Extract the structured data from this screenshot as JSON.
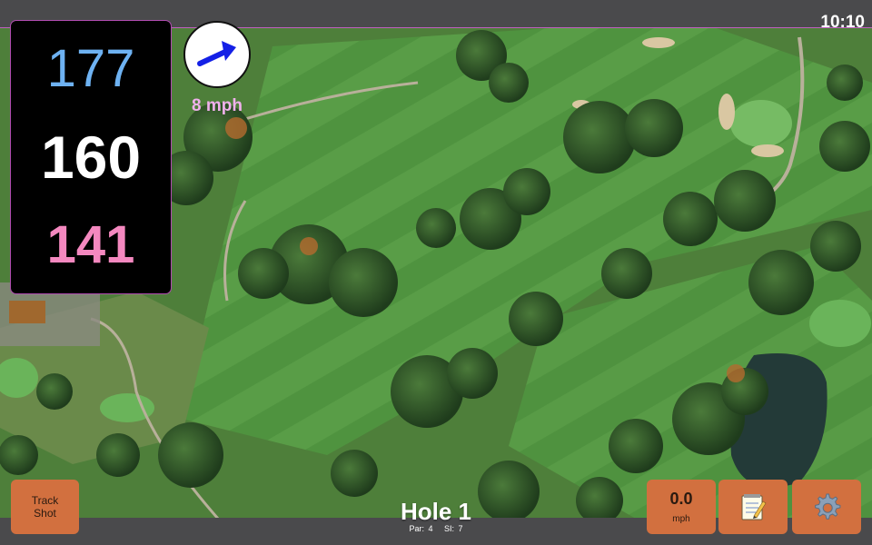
{
  "status_bar": {
    "time": "10:10"
  },
  "distances": {
    "back": "177",
    "middle": "160",
    "front": "141"
  },
  "wind": {
    "speed": "8 mph",
    "direction_icon": "wind-arrow-icon"
  },
  "hole": {
    "title": "Hole 1",
    "par": "Par: 4",
    "stroke_index": "SI: 7"
  },
  "buttons": {
    "track_shot_line1": "Track",
    "track_shot_line2": "Shot",
    "speed_value": "0.0",
    "speed_unit": "mph",
    "notes_icon": "notepad-icon",
    "settings_icon": "gear-icon"
  },
  "colors": {
    "card_border": "#b04cb0",
    "back_distance": "#6eb2f2",
    "front_distance": "#f488bf",
    "wind_text": "#f0b0ec",
    "button": "#d2703f"
  }
}
